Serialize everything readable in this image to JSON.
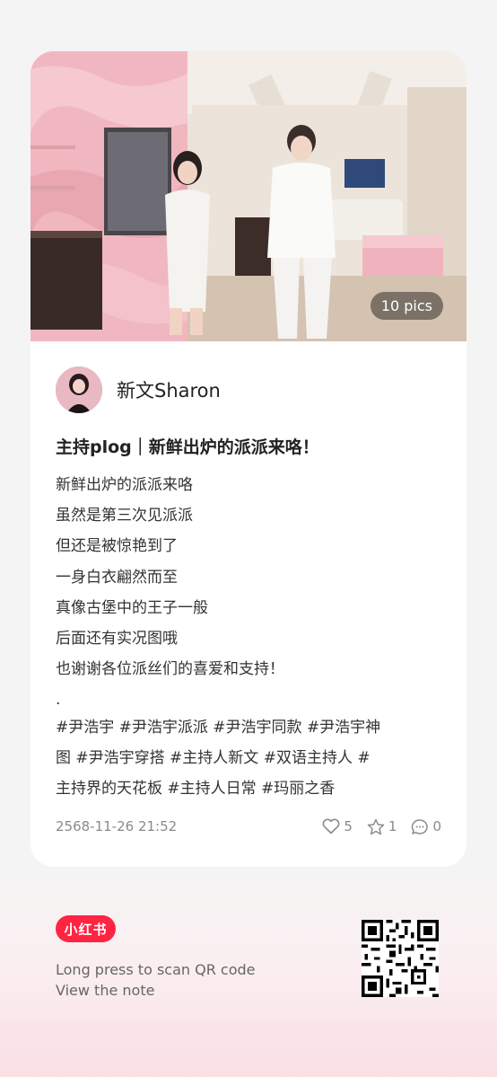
{
  "photo": {
    "badge": "10 pics"
  },
  "author": {
    "name": "新文Sharon"
  },
  "post": {
    "title": "主持plog｜新鲜出炉的派派来咯！",
    "lines": [
      "新鲜出炉的派派来咯",
      "虽然是第三次见派派",
      "但还是被惊艳到了",
      "一身白衣翩然而至",
      "真像古堡中的王子一般",
      "后面还有实况图哦",
      "也谢谢各位派丝们的喜爱和支持！",
      "."
    ],
    "tag_lines": [
      "#尹浩宇  #尹浩宇派派  #尹浩宇同款  #尹浩宇神",
      "图  #尹浩宇穿搭  #主持人新文  #双语主持人  #",
      "主持界的天花板  #主持人日常  #玛丽之香"
    ]
  },
  "meta": {
    "date": "2568-11-26 21:52",
    "likes": "5",
    "collects": "1",
    "comments": "0"
  },
  "footer": {
    "brand": "小红书",
    "line1": "Long press to scan QR code",
    "line2": "View the note"
  },
  "colors": {
    "brand": "#ff2442",
    "text": "#222222",
    "muted": "#8a8a8a"
  },
  "icons": [
    "heart-icon",
    "star-icon",
    "comment-icon",
    "qr-code"
  ]
}
